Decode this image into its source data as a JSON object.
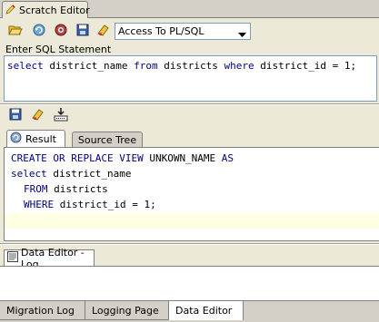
{
  "editor_tab": {
    "label": "Scratch Editor"
  },
  "toolbar": {
    "buttons": [
      "open-icon",
      "refresh-icon",
      "connect-icon",
      "save-icon",
      "clear-icon"
    ],
    "dropdown_value": "Access To PL/SQL"
  },
  "sql_statement": {
    "label": "Enter SQL Statement",
    "tokens": [
      "select",
      "district_name",
      "from",
      "districts",
      "where",
      "district_id = 1;"
    ]
  },
  "result_toolbar": {
    "buttons": [
      "save-icon",
      "clear-icon",
      "export-icon"
    ]
  },
  "result_tabs": [
    {
      "label": "Result",
      "active": true
    },
    {
      "label": "Source Tree",
      "active": false
    }
  ],
  "result_code": {
    "line1": {
      "kw1": "CREATE OR REPLACE VIEW",
      "name": " UNKOWN_NAME ",
      "kw2": "AS"
    },
    "line2": {
      "kw": "select",
      "rest": " district_name"
    },
    "line3": {
      "kw": "FROM",
      "rest": " districts"
    },
    "line4": {
      "kw": "WHERE",
      "rest": " district_id = 1;"
    }
  },
  "log_tab": {
    "label": "Data Editor - Log"
  },
  "bottom_tabs": [
    {
      "label": "Migration Log",
      "active": false
    },
    {
      "label": "Logging Page",
      "active": false
    },
    {
      "label": "Data Editor",
      "active": true
    }
  ],
  "colors": {
    "keyword": "#000080",
    "highlight_line": "#ffffe4",
    "panel_bg": "#ece9d8"
  }
}
